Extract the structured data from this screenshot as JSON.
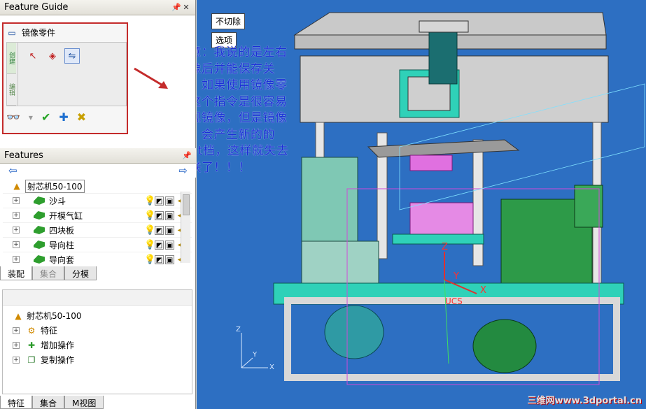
{
  "feature_guide": {
    "title": "Feature Guide",
    "pin_icon": "pin-icon",
    "close_icon": "close-icon",
    "command_label": "镜像零件",
    "vtab_1": "创建",
    "vtab_2": "编辑"
  },
  "features_panel": {
    "title": "Features",
    "root_label": "射芯机50-100",
    "items": [
      {
        "label": "沙斗"
      },
      {
        "label": "开模气缸"
      },
      {
        "label": "四块板"
      },
      {
        "label": "导向柱"
      },
      {
        "label": "导向套"
      }
    ],
    "tabs": [
      "装配",
      "集合",
      "分模"
    ]
  },
  "model_tree": {
    "root_label": "射芯机50-100",
    "items": [
      {
        "label": "特征",
        "icon": "feature-icon"
      },
      {
        "label": "增加操作",
        "icon": "add-op-icon"
      },
      {
        "label": "复制操作",
        "icon": "copy-op-icon"
      }
    ],
    "tabs": [
      "特征",
      "集合",
      "M视图"
    ]
  },
  "viewport": {
    "btn_no_cut": "不切除",
    "btn_options": "选项",
    "note_text": "注意：我说的是左右镜像后并能保存关联，如果使用镜像零件这个指令是很容易实现镜像，但是镜像后，会产生新的的prat档，这样就失去关联了！！！",
    "axis_z": "Z",
    "axis_y": "Y",
    "axis_x": "X",
    "axis_label_ucs": "UCS",
    "watermark": "三维网www.3dportal.cn"
  },
  "colors": {
    "viewport_bg": "#2d6fc2",
    "highlight_box": "#c42b2b",
    "note_text": "#1a2fd6"
  }
}
